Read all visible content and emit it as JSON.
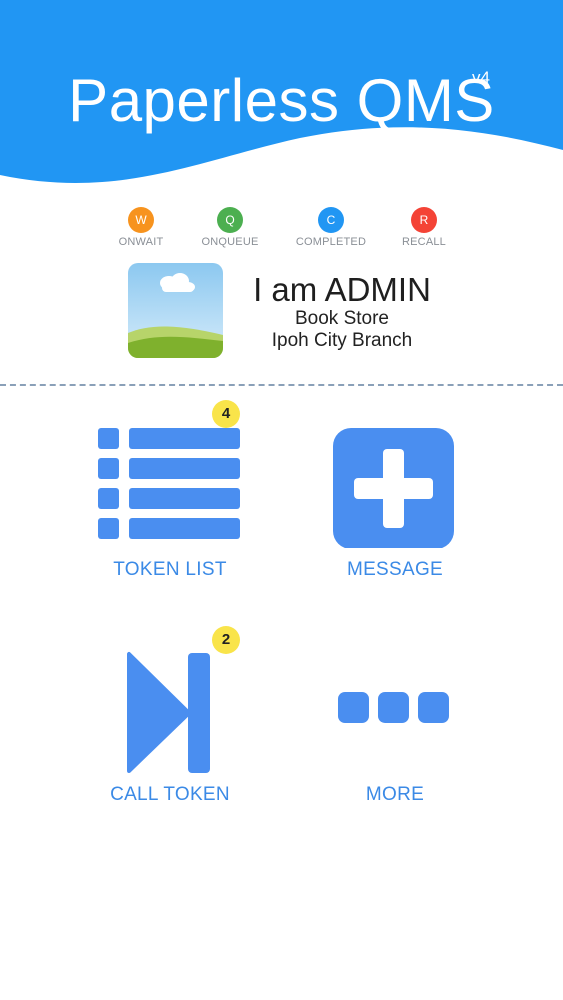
{
  "app": {
    "title": "Paperless QMS",
    "version": "v4"
  },
  "legend": [
    {
      "letter": "W",
      "label": "ONWAIT",
      "color": "#f7931e"
    },
    {
      "letter": "Q",
      "label": "ONQUEUE",
      "color": "#4caf50"
    },
    {
      "letter": "C",
      "label": "COMPLETED",
      "color": "#2196f3"
    },
    {
      "letter": "R",
      "label": "RECALL",
      "color": "#f44336"
    }
  ],
  "profile": {
    "name": "I am ADMIN",
    "store": "Book Store",
    "branch": "Ipoh City Branch"
  },
  "menu": {
    "token_list": {
      "label": "TOKEN LIST",
      "badge": "4"
    },
    "message": {
      "label": "MESSAGE"
    },
    "call_token": {
      "label": "CALL TOKEN",
      "badge": "2"
    },
    "more": {
      "label": "MORE"
    }
  },
  "colors": {
    "brand_blue": "#2196f3",
    "icon_blue": "#4a8ef0",
    "badge_yellow": "#f9e44a"
  }
}
